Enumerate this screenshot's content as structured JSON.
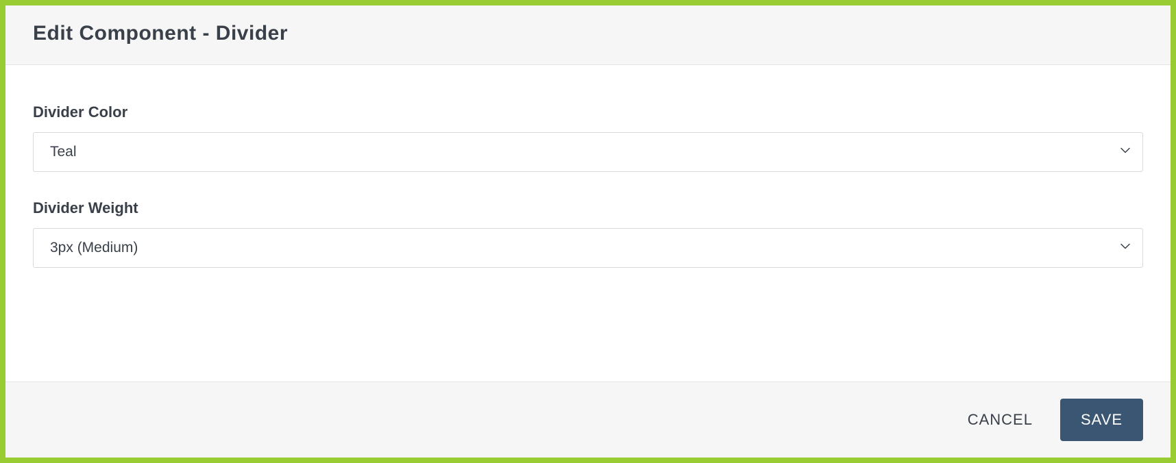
{
  "header": {
    "title": "Edit Component - Divider"
  },
  "form": {
    "color": {
      "label": "Divider Color",
      "value": "Teal"
    },
    "weight": {
      "label": "Divider Weight",
      "value": "3px (Medium)"
    }
  },
  "footer": {
    "cancel": "CANCEL",
    "save": "SAVE"
  }
}
